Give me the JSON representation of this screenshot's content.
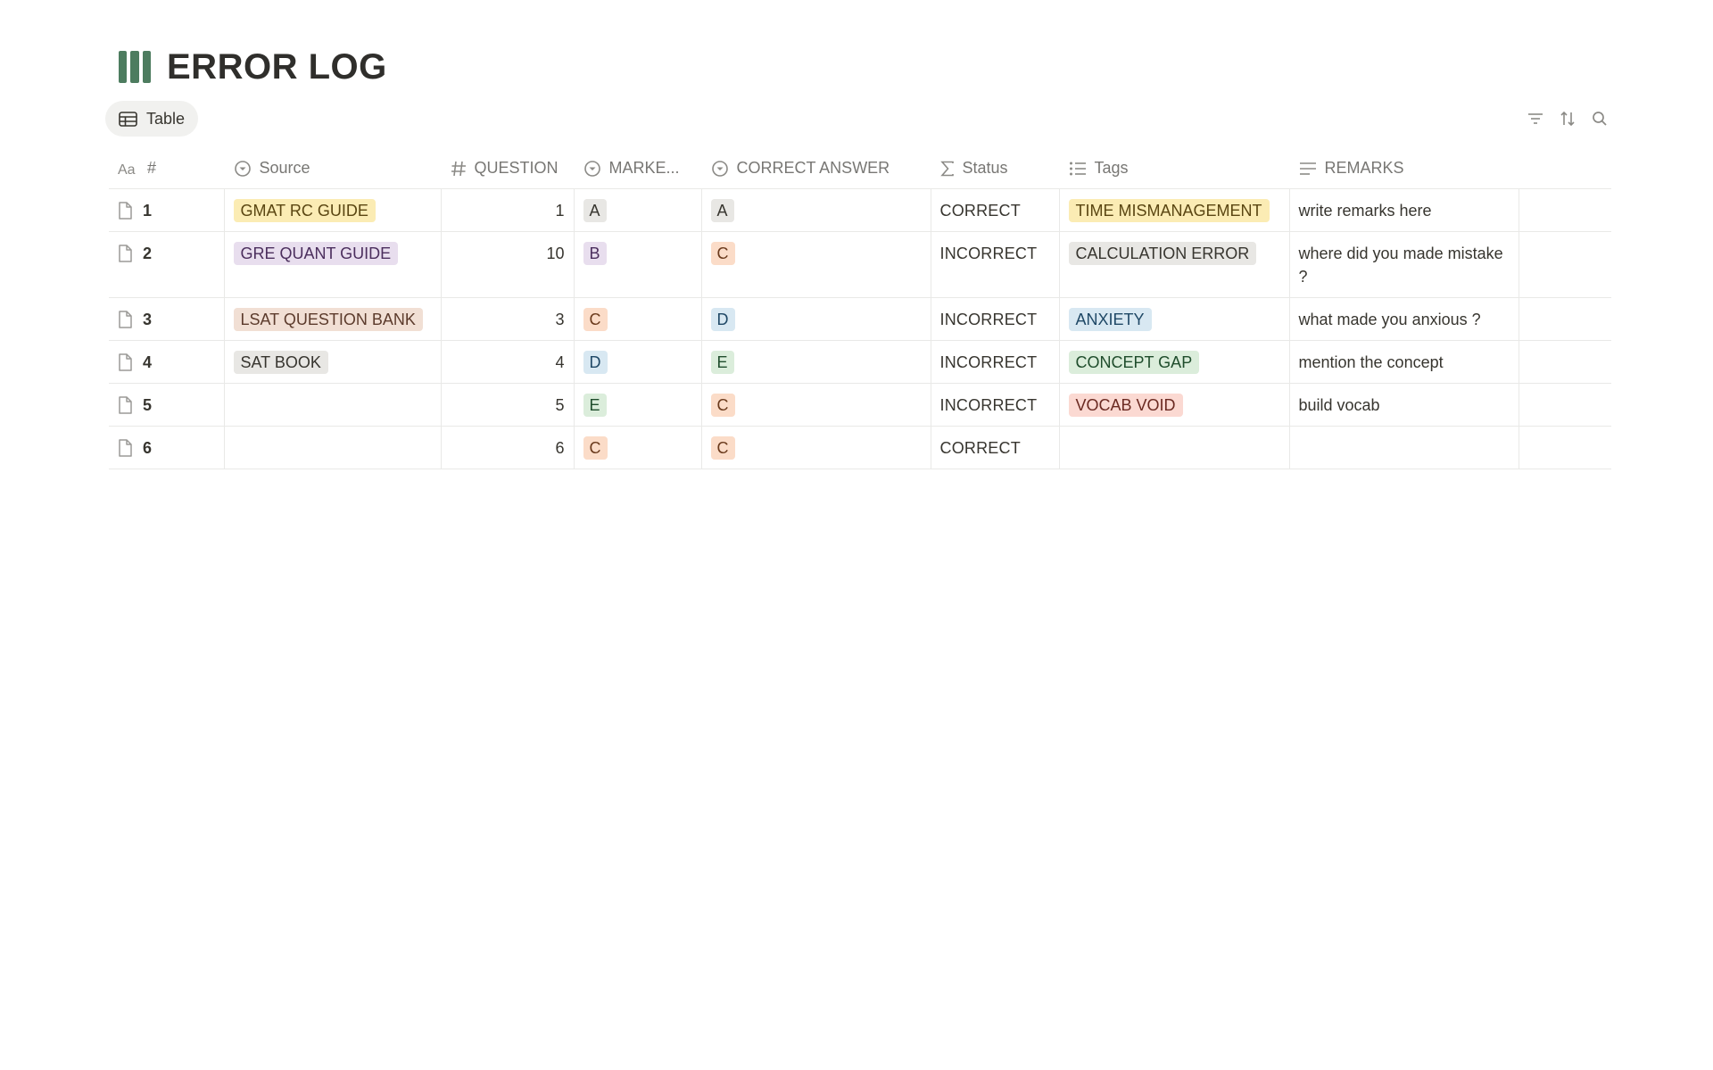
{
  "page": {
    "title": "ERROR LOG",
    "icon": "bars-icon",
    "view_tab": "Table"
  },
  "columns": {
    "name": "#",
    "source": "Source",
    "question": "QUESTION",
    "marked": "MARKE...",
    "correct": "CORRECT ANSWER",
    "status": "Status",
    "tags": "Tags",
    "remarks": "REMARKS"
  },
  "tag_colors": {
    "yellow": {
      "bg": "#fbecb4",
      "fg": "#5a4612"
    },
    "purple": {
      "bg": "#e8deee",
      "fg": "#4b2e5d"
    },
    "brown": {
      "bg": "#f1dfd4",
      "fg": "#5c3b2c"
    },
    "gray": {
      "bg": "#e8e7e4",
      "fg": "#37352f"
    },
    "orange": {
      "bg": "#fbdcc8",
      "fg": "#6a3a1c"
    },
    "blue": {
      "bg": "#d8e8f2",
      "fg": "#1f4866"
    },
    "green": {
      "bg": "#dbeddb",
      "fg": "#1f4d2c"
    },
    "red": {
      "bg": "#fbd9d2",
      "fg": "#6b2a22"
    }
  },
  "rows": [
    {
      "name": "1",
      "source": {
        "text": "GMAT RC GUIDE",
        "color": "yellow"
      },
      "question": "1",
      "marked": {
        "text": "A",
        "color": "gray"
      },
      "correct": {
        "text": "A",
        "color": "gray"
      },
      "status": "CORRECT",
      "tag": {
        "text": "TIME MISMANAGEMENT",
        "color": "yellow"
      },
      "remarks": "write remarks here"
    },
    {
      "name": "2",
      "source": {
        "text": "GRE QUANT GUIDE",
        "color": "purple"
      },
      "question": "10",
      "marked": {
        "text": "B",
        "color": "purple"
      },
      "correct": {
        "text": "C",
        "color": "orange"
      },
      "status": "INCORRECT",
      "tag": {
        "text": "CALCULATION ERROR",
        "color": "gray"
      },
      "remarks": "where did you made mistake ?"
    },
    {
      "name": "3",
      "source": {
        "text": "LSAT QUESTION BANK",
        "color": "brown"
      },
      "question": "3",
      "marked": {
        "text": "C",
        "color": "orange"
      },
      "correct": {
        "text": "D",
        "color": "blue"
      },
      "status": "INCORRECT",
      "tag": {
        "text": "ANXIETY",
        "color": "blue"
      },
      "remarks": "what made you anxious ?"
    },
    {
      "name": "4",
      "source": {
        "text": "SAT BOOK",
        "color": "gray"
      },
      "question": "4",
      "marked": {
        "text": "D",
        "color": "blue"
      },
      "correct": {
        "text": "E",
        "color": "green"
      },
      "status": "INCORRECT",
      "tag": {
        "text": "CONCEPT GAP",
        "color": "green"
      },
      "remarks": "mention the concept"
    },
    {
      "name": "5",
      "source": null,
      "question": "5",
      "marked": {
        "text": "E",
        "color": "green"
      },
      "correct": {
        "text": "C",
        "color": "orange"
      },
      "status": "INCORRECT",
      "tag": {
        "text": "VOCAB VOID",
        "color": "red"
      },
      "remarks": "build vocab"
    },
    {
      "name": "6",
      "source": null,
      "question": "6",
      "marked": {
        "text": "C",
        "color": "orange"
      },
      "correct": {
        "text": "C",
        "color": "orange"
      },
      "status": "CORRECT",
      "tag": null,
      "remarks": ""
    }
  ]
}
